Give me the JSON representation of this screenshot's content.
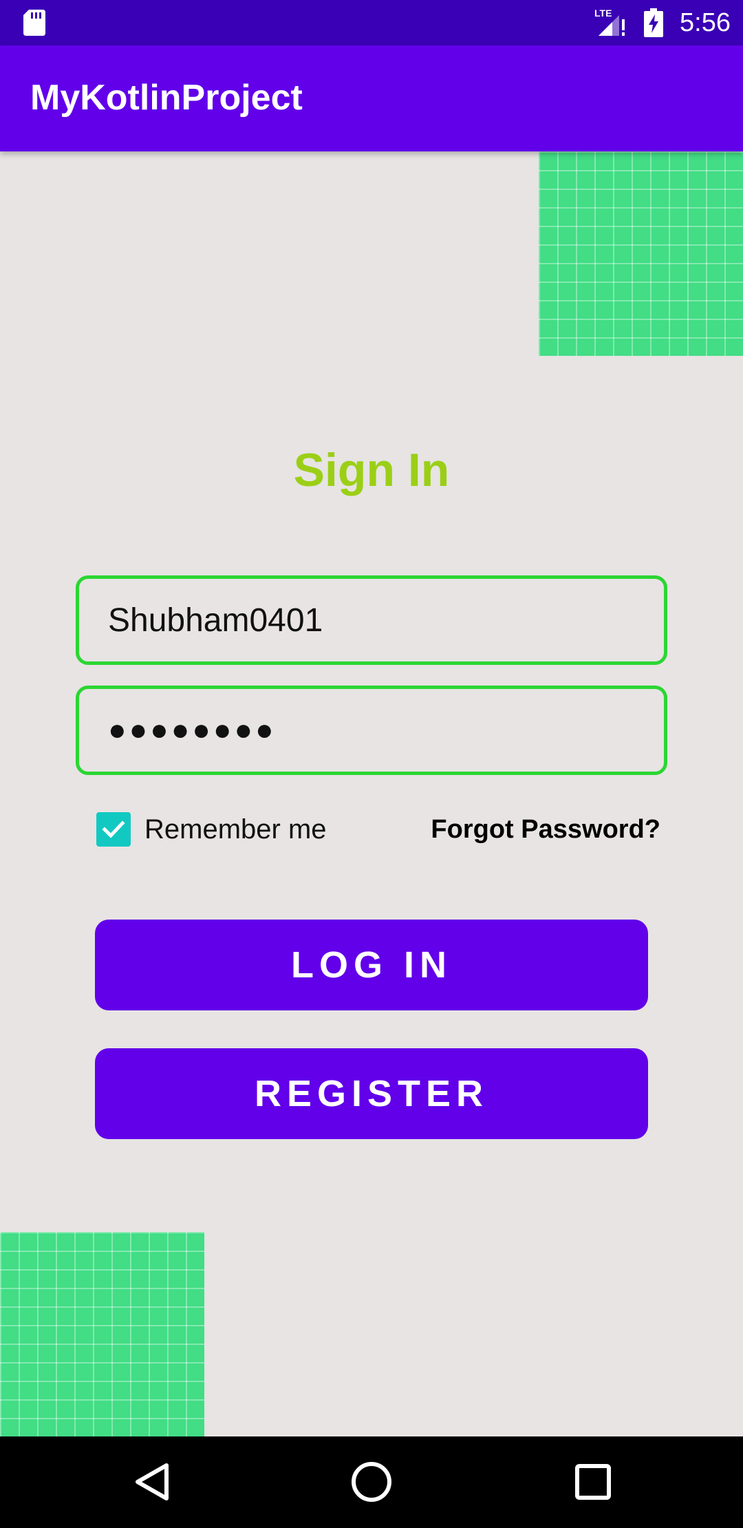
{
  "status_bar": {
    "time": "5:56",
    "network_label": "LTE",
    "icons": [
      "sd-card-icon",
      "lte-signal-icon",
      "battery-charging-icon"
    ]
  },
  "app_bar": {
    "title": "MyKotlinProject"
  },
  "login_form": {
    "heading": "Sign In",
    "username_value": "Shubham0401",
    "password_value": "●●●●●●●●",
    "remember_label": "Remember me",
    "remember_checked": true,
    "forgot_label": "Forgot Password?",
    "login_label": "LOG IN",
    "register_label": "REGISTER"
  },
  "navigation_bar": {
    "icons": [
      "back-icon",
      "home-icon",
      "recents-icon"
    ]
  },
  "colors": {
    "status_bar": "#3A00B5",
    "app_bar": "#6200EA",
    "background": "#E7E4E3",
    "heading": "#9BCF16",
    "input_border": "#2BD632",
    "checkbox": "#12C9C2",
    "button": "#6200EA",
    "decoration": "#42DD85"
  }
}
